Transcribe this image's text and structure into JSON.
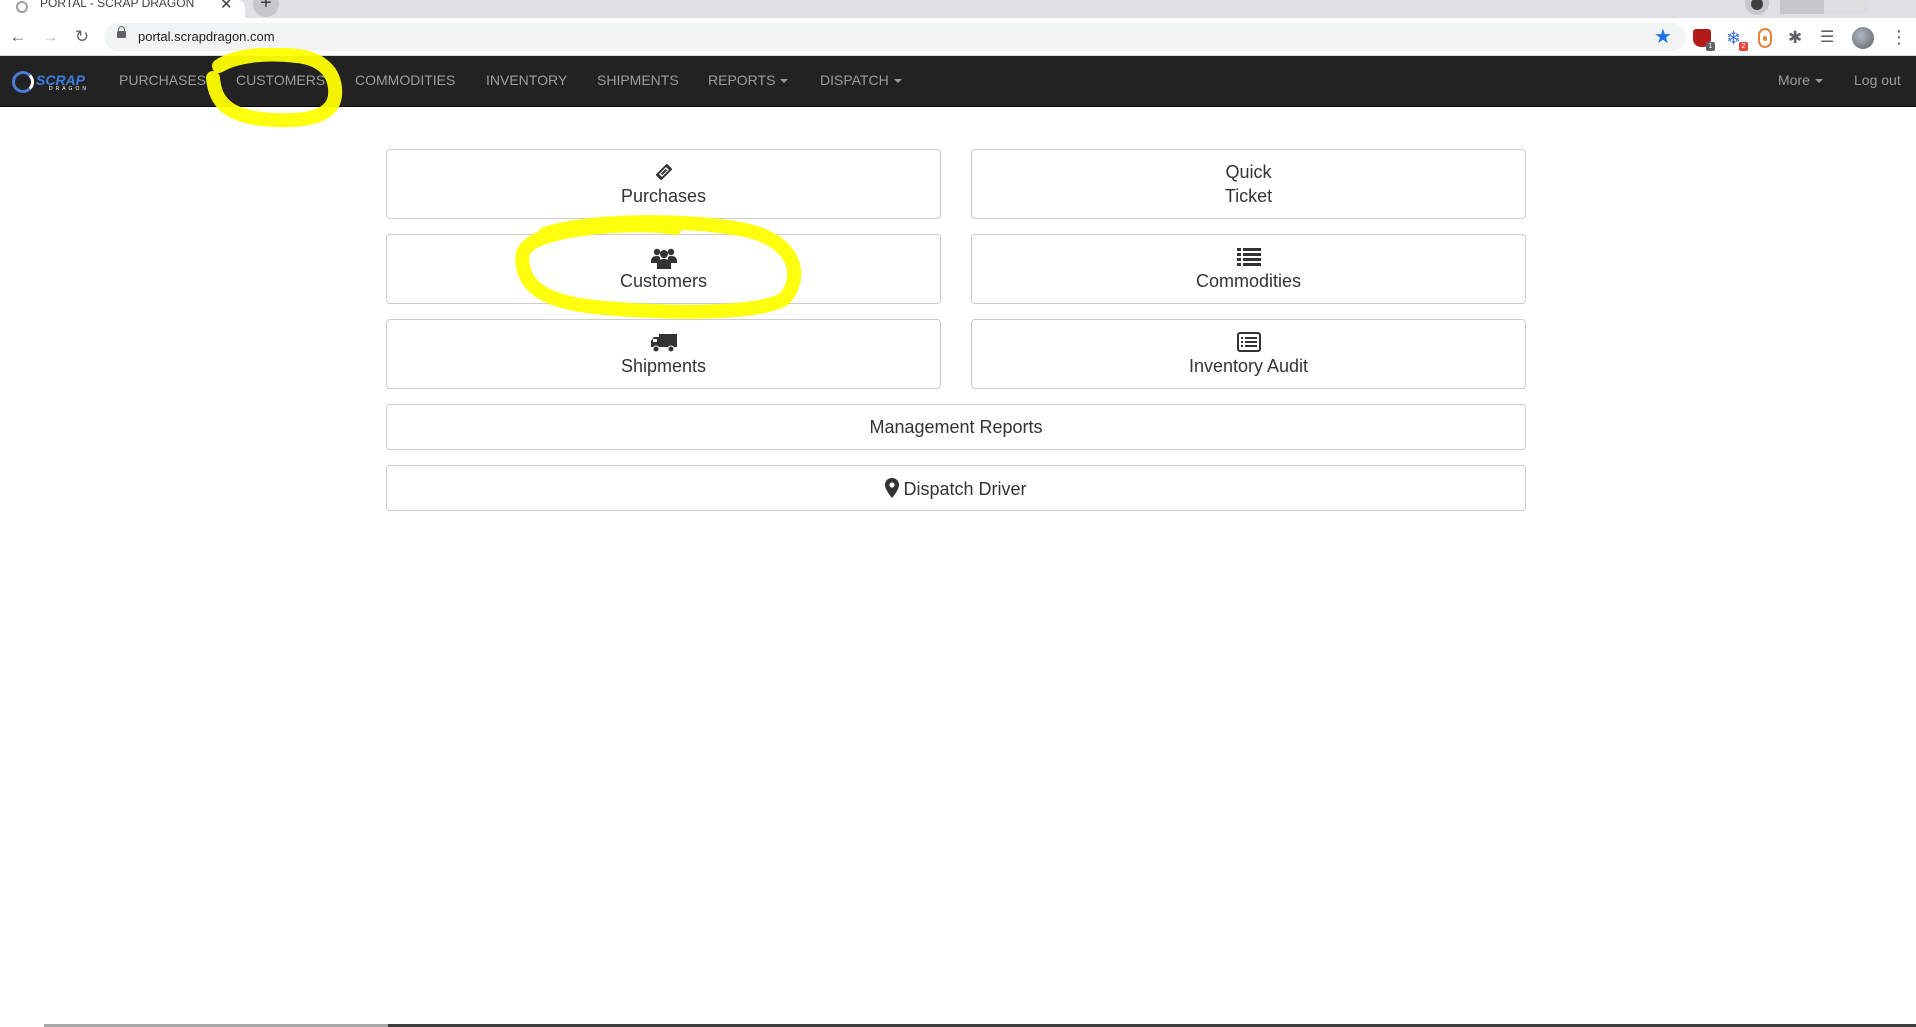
{
  "browser": {
    "tab_title": "PORTAL - SCRAP DRAGON",
    "tab_close": "✕",
    "new_tab": "+",
    "url": "portal.scrapdragon.com",
    "ext_badge_1": "1",
    "ext_badge_2": "2"
  },
  "navbar": {
    "brand": "SCRAP",
    "brand_sub": "DRAGON",
    "links": [
      "PURCHASES",
      "CUSTOMERS",
      "COMMODITIES",
      "INVENTORY",
      "SHIPMENTS",
      "REPORTS",
      "DISPATCH"
    ],
    "more": "More",
    "logout": "Log out"
  },
  "tiles": {
    "purchases": "Purchases",
    "quick_ticket_line1": "Quick",
    "quick_ticket_line2": "Ticket",
    "customers": "Customers",
    "commodities": "Commodities",
    "shipments": "Shipments",
    "inventory_audit": "Inventory Audit",
    "management_reports": "Management Reports",
    "dispatch_driver": "Dispatch Driver"
  },
  "colors": {
    "navbar_bg": "#222222",
    "nav_link": "#9d9d9d",
    "highlight": "#ffff00",
    "brand": "#3d7de0"
  }
}
